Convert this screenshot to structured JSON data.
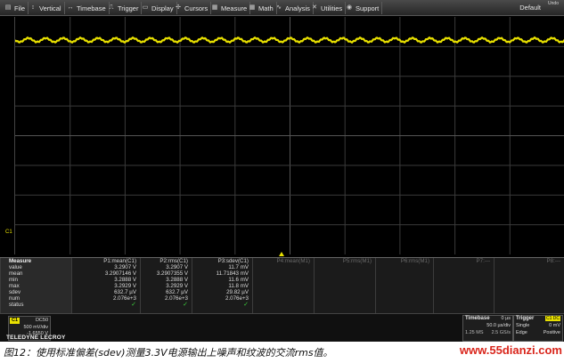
{
  "menu": {
    "items": [
      {
        "label": "File",
        "icon": "file-icon"
      },
      {
        "label": "Vertical",
        "icon": "vertical-icon"
      },
      {
        "label": "Timebase",
        "icon": "timebase-icon"
      },
      {
        "label": "Trigger",
        "icon": "trigger-icon"
      },
      {
        "label": "Display",
        "icon": "display-icon"
      },
      {
        "label": "Cursors",
        "icon": "cursors-icon"
      },
      {
        "label": "Measure",
        "icon": "measure-icon"
      },
      {
        "label": "Math",
        "icon": "math-icon"
      },
      {
        "label": "Analysis",
        "icon": "analysis-icon"
      },
      {
        "label": "Utilities",
        "icon": "utilities-icon"
      },
      {
        "label": "Support",
        "icon": "support-icon"
      }
    ],
    "default_label": "Default",
    "undo_label": "Undo"
  },
  "trace": {
    "channel_label": "C1",
    "color": "#e8e000"
  },
  "measure": {
    "row_labels": [
      "Measure",
      "value",
      "mean",
      "min",
      "max",
      "sdev",
      "num",
      "status"
    ],
    "columns": [
      {
        "header": "P1:mean(C1)",
        "value": "3.2907 V",
        "mean": "3.2907146 V",
        "min": "3.2888 V",
        "max": "3.2929 V",
        "sdev": "632.7 µV",
        "num": "2.076e+3",
        "status": "✓"
      },
      {
        "header": "P2:rms(C1)",
        "value": "3.2907 V",
        "mean": "3.2907355 V",
        "min": "3.2888 V",
        "max": "3.2929 V",
        "sdev": "632.7 µV",
        "num": "2.076e+3",
        "status": "✓"
      },
      {
        "header": "P3:sdev(C1)",
        "value": "11.7 mV",
        "mean": "11.71843 mV",
        "min": "11.6 mV",
        "max": "11.8 mV",
        "sdev": "29.82 µV",
        "num": "2.076e+3",
        "status": "✓"
      },
      {
        "header": "P4:mean(M1)"
      },
      {
        "header": "P5:rms(M1)"
      },
      {
        "header": "P6:rms(M1)"
      },
      {
        "header": "P7:---"
      },
      {
        "header": "P8:---"
      }
    ]
  },
  "channel": {
    "badge": "C1",
    "coupling": "DC50",
    "vdiv": "500 mV/div",
    "offset": "-1.6550 V"
  },
  "brand": "TELEDYNE LECROY",
  "timebase": {
    "title": "Timebase",
    "delay": "0 µs",
    "div": "50.0 µs/div",
    "sample_rate": "1.25 MS",
    "points": "2.5 GS/s"
  },
  "trigger": {
    "title": "Trigger",
    "source": "C1 DC",
    "mode": "Single",
    "level": "0 mV",
    "type": "Edge",
    "slope": "Positive"
  },
  "caption": "图12：使用标准偏差(sdev)测量3.3V电源输出上噪声和纹波的交流rms值。",
  "watermark": "www.55dianzi.com"
}
